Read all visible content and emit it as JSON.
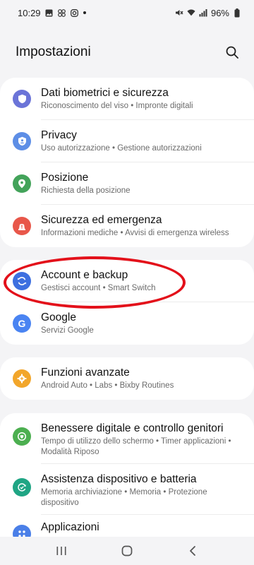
{
  "status": {
    "time": "10:29",
    "battery": "96%"
  },
  "header": {
    "title": "Impostazioni"
  },
  "groups": [
    {
      "items": [
        {
          "title": "Dati biometrici e sicurezza",
          "subtitle": "Riconoscimento del viso  •  Impronte digitali",
          "icon": "shield-icon",
          "color": "#6b74d8"
        },
        {
          "title": "Privacy",
          "subtitle": "Uso autorizzazione  •  Gestione autorizzazioni",
          "icon": "privacy-shield-icon",
          "color": "#5d8ee6"
        },
        {
          "title": "Posizione",
          "subtitle": "Richiesta della posizione",
          "icon": "location-pin-icon",
          "color": "#43a35a"
        },
        {
          "title": "Sicurezza ed emergenza",
          "subtitle": "Informazioni mediche  •  Avvisi di emergenza wireless",
          "icon": "emergency-icon",
          "color": "#e8574a"
        }
      ]
    },
    {
      "items": [
        {
          "title": "Account e backup",
          "subtitle": "Gestisci account  •  Smart Switch",
          "icon": "sync-icon",
          "color": "#3d6fe0"
        },
        {
          "title": "Google",
          "subtitle": "Servizi Google",
          "icon": "google-icon",
          "color": "#4a84f2"
        }
      ]
    },
    {
      "items": [
        {
          "title": "Funzioni avanzate",
          "subtitle": "Android Auto  •  Labs  •  Bixby Routines",
          "icon": "gear-plus-icon",
          "color": "#f2a62b"
        }
      ]
    },
    {
      "items": [
        {
          "title": "Benessere digitale e controllo genitori",
          "subtitle": "Tempo di utilizzo dello schermo  •  Timer applicazioni  •  Modalità Riposo",
          "icon": "wellbeing-icon",
          "color": "#4caf50"
        },
        {
          "title": "Assistenza dispositivo e batteria",
          "subtitle": "Memoria archiviazione  •  Memoria  •  Protezione dispositivo",
          "icon": "device-care-icon",
          "color": "#1fa584"
        },
        {
          "title": "Applicazioni",
          "subtitle": "",
          "icon": "apps-icon",
          "color": "#4a7fe8"
        }
      ]
    }
  ]
}
